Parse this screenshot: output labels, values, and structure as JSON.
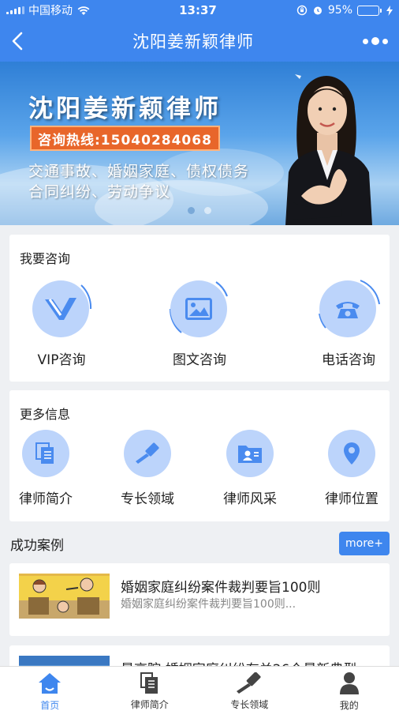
{
  "status_bar": {
    "carrier": "中国移动",
    "time": "13:37",
    "battery": "95%",
    "battery_level": 0.95
  },
  "nav": {
    "title": "沈阳姜新颖律师",
    "back_icon": "back-arrow-icon",
    "more_icon": "more-dots-icon"
  },
  "banner": {
    "title": "沈阳姜新颖律师",
    "hotline": "咨询热线:15040284068",
    "line1": "交通事故、婚姻家庭、债权债务",
    "line2": "合同纠纷、劳动争议",
    "slide_count": 2,
    "active_slide": 1
  },
  "consult": {
    "title": "我要咨询",
    "items": [
      {
        "label": "VIP咨询",
        "icon": "vip-icon"
      },
      {
        "label": "图文咨询",
        "icon": "image-icon"
      },
      {
        "label": "电话咨询",
        "icon": "telephone-icon"
      }
    ]
  },
  "more_info": {
    "title": "更多信息",
    "items": [
      {
        "label": "律师简介",
        "icon": "document-icon"
      },
      {
        "label": "专长领域",
        "icon": "gavel-icon"
      },
      {
        "label": "律师风采",
        "icon": "folder-id-icon"
      },
      {
        "label": "律师位置",
        "icon": "location-pin-icon"
      }
    ]
  },
  "cases": {
    "title": "成功案例",
    "more_label": "more+",
    "items": [
      {
        "title": "婚姻家庭纠纷案件裁判要旨100则",
        "subtitle": "婚姻家庭纠纷案件裁判要旨100则..."
      },
      {
        "title": "最高院:婚姻家庭纠纷有关26个最新典型",
        "subtitle": ""
      }
    ]
  },
  "tab_bar": {
    "items": [
      {
        "label": "首页",
        "icon": "home-icon",
        "active": true
      },
      {
        "label": "律师简介",
        "icon": "document-icon",
        "active": false
      },
      {
        "label": "专长领域",
        "icon": "gavel-icon",
        "active": false
      },
      {
        "label": "我的",
        "icon": "user-icon",
        "active": false
      }
    ]
  },
  "colors": {
    "primary": "#3e86ee",
    "icon_circle": "#bcd4fb",
    "icon_fg": "#4a8bef",
    "hotline_bg": "#e8662a"
  }
}
